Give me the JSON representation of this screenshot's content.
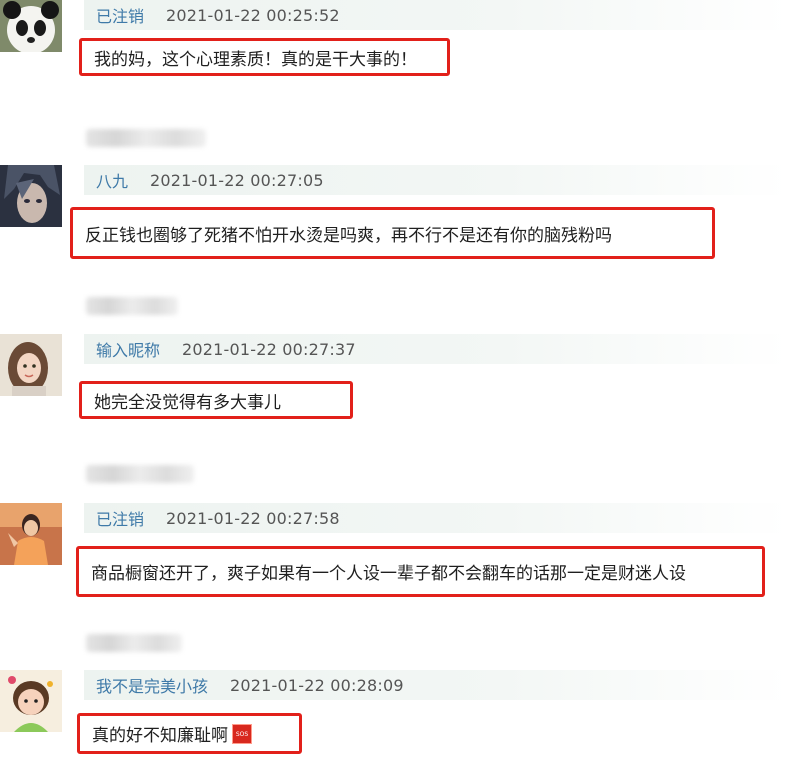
{
  "comments": [
    {
      "user": "已注销",
      "time": "2021-01-22 00:25:52",
      "text": "我的妈，这个心理素质！真的是干大事的！",
      "avatar_icon": "panda-avatar-icon"
    },
    {
      "user": "八九",
      "time": "2021-01-22 00:27:05",
      "text": "反正钱也圈够了死猪不怕开水烫是吗爽，再不行不是还有你的脑残粉吗",
      "avatar_icon": "anime-face-avatar-icon"
    },
    {
      "user": "输入昵称",
      "time": "2021-01-22 00:27:37",
      "text": "她完全没觉得有多大事儿",
      "avatar_icon": "girl-avatar-icon"
    },
    {
      "user": "已注销",
      "time": "2021-01-22 00:27:58",
      "text": "商品橱窗还开了，爽子如果有一个人设一辈子都不会翻车的话那一定是财迷人设",
      "avatar_icon": "woman-orange-avatar-icon"
    },
    {
      "user": "我不是完美小孩",
      "time": "2021-01-22 00:28:09",
      "text": "真的好不知廉耻啊",
      "avatar_icon": "child-avatar-icon",
      "emoji": "SOS"
    }
  ],
  "colors": {
    "highlight_border": "#e2201a",
    "username": "#3f7aa8",
    "meta_bg": "#edf3f0"
  }
}
